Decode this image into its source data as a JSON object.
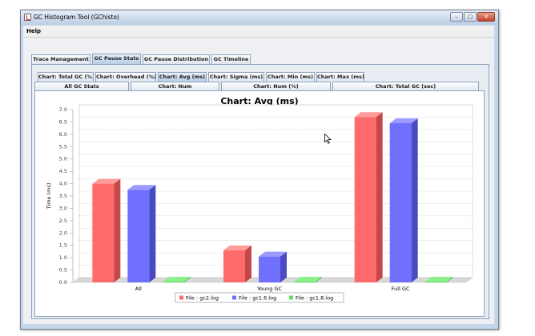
{
  "window": {
    "title": "GC Histogram Tool (GChisto)",
    "minimize_glyph": "–",
    "maximize_glyph": "▢",
    "close_glyph": "✕",
    "icon": "app-icon"
  },
  "menu": {
    "help": "Help"
  },
  "main_tabs": [
    {
      "label": "Trace Management",
      "selected": false
    },
    {
      "label": "GC Pause Stats",
      "selected": true
    },
    {
      "label": "GC Pause Distribution",
      "selected": false
    },
    {
      "label": "GC Timeline",
      "selected": false
    }
  ],
  "chart_tabs": [
    {
      "label": "Chart: Total GC (%)",
      "selected": false
    },
    {
      "label": "Chart: Overhead (%)",
      "selected": false
    },
    {
      "label": "Chart: Avg (ms)",
      "selected": true
    },
    {
      "label": "Chart: Sigma (ms)",
      "selected": false
    },
    {
      "label": "Chart: Min (ms)",
      "selected": false
    },
    {
      "label": "Chart: Max (ms)",
      "selected": false
    }
  ],
  "stat_tabs": [
    {
      "label": "All GC Stats"
    },
    {
      "label": "Chart: Num"
    },
    {
      "label": "Chart: Num (%)"
    },
    {
      "label": "Chart: Total GC (sec)"
    }
  ],
  "colors": {
    "series": [
      "#ff6b6b",
      "#7070ff",
      "#5fe05f"
    ],
    "series_dark": [
      "#c44848",
      "#4a4ac4",
      "#3da83d"
    ],
    "series_top": [
      "#ff9a9a",
      "#9a9aff",
      "#8cf08c"
    ],
    "grid": "#b8b8b8",
    "floor": "#d8d8d8"
  },
  "chart_data": {
    "type": "bar",
    "title": "Chart: Avg (ms)",
    "xlabel": "",
    "ylabel": "Time (ms)",
    "categories": [
      "All",
      "Young GC",
      "Full GC"
    ],
    "series": [
      {
        "name": "File : gc2.log",
        "values": [
          4.0,
          1.3,
          6.7
        ]
      },
      {
        "name": "File : gc1.6.log",
        "values": [
          3.75,
          1.05,
          6.45
        ]
      },
      {
        "name": "File : gc1.8.log",
        "values": [
          0.0,
          0.0,
          0.0
        ]
      }
    ],
    "ylim": [
      0,
      7.0
    ],
    "yticks": [
      "0.0",
      "0.5",
      "1.0",
      "1.5",
      "2.0",
      "2.5",
      "3.0",
      "3.5",
      "4.0",
      "4.5",
      "5.0",
      "5.5",
      "6.0",
      "6.5",
      "7.0"
    ],
    "grid": true,
    "legend": "bottom"
  },
  "cursor": "pointer-cursor-icon"
}
